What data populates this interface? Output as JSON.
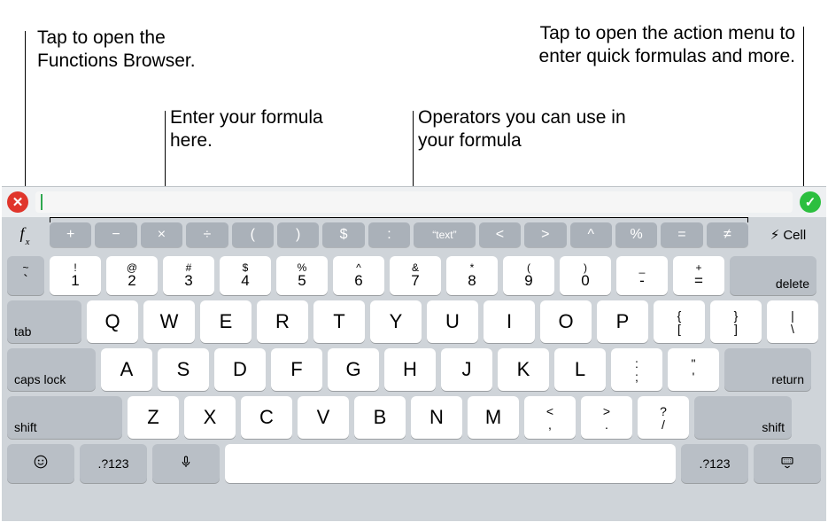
{
  "callouts": {
    "fx": "Tap to open the Functions Browser.",
    "field": "Enter your formula here.",
    "ops": "Operators you can use in your formula",
    "action": "Tap to open the action menu to enter quick formulas and more."
  },
  "formula_bar": {
    "cancel_glyph": "✕",
    "accept_glyph": "✓",
    "input_value": ""
  },
  "toolbar": {
    "fx_label_main": "f",
    "fx_label_sub": "x",
    "cell_label": "Cell",
    "bolt_glyph": "⚡︎",
    "operators": [
      "+",
      "−",
      "×",
      "÷",
      "(",
      ")",
      "$",
      ":",
      "“text”",
      "<",
      ">",
      "^",
      "%",
      "=",
      "≠"
    ]
  },
  "keyboard": {
    "row1": [
      {
        "top": "~",
        "bot": "`"
      },
      {
        "top": "!",
        "bot": "1"
      },
      {
        "top": "@",
        "bot": "2"
      },
      {
        "top": "#",
        "bot": "3"
      },
      {
        "top": "$",
        "bot": "4"
      },
      {
        "top": "%",
        "bot": "5"
      },
      {
        "top": "^",
        "bot": "6"
      },
      {
        "top": "&",
        "bot": "7"
      },
      {
        "top": "*",
        "bot": "8"
      },
      {
        "top": "(",
        "bot": "9"
      },
      {
        "top": ")",
        "bot": "0"
      },
      {
        "top": "_",
        "bot": "-"
      },
      {
        "top": "+",
        "bot": "="
      }
    ],
    "delete_label": "delete",
    "tab_label": "tab",
    "row2": [
      "Q",
      "W",
      "E",
      "R",
      "T",
      "Y",
      "U",
      "I",
      "O",
      "P"
    ],
    "row2_tail": [
      {
        "top": "{",
        "bot": "["
      },
      {
        "top": "}",
        "bot": "]"
      },
      {
        "top": "|",
        "bot": "\\"
      }
    ],
    "caps_label": "caps lock",
    "row3": [
      "A",
      "S",
      "D",
      "F",
      "G",
      "H",
      "J",
      "K",
      "L"
    ],
    "row3_tail": [
      {
        "top": ":",
        "bot": ";"
      },
      {
        "top": "\"",
        "bot": "'"
      }
    ],
    "return_label": "return",
    "shift_label": "shift",
    "row4": [
      "Z",
      "X",
      "C",
      "V",
      "B",
      "N",
      "M"
    ],
    "row4_tail": [
      {
        "top": "<",
        "bot": ","
      },
      {
        "top": ">",
        "bot": "."
      },
      {
        "top": "?",
        "bot": "/"
      }
    ],
    "row5": {
      "emoji_glyph": "☺",
      "numsym_label": ".?123",
      "mic_glyph": "🎤︎",
      "dismiss_glyph": "⌨"
    }
  }
}
